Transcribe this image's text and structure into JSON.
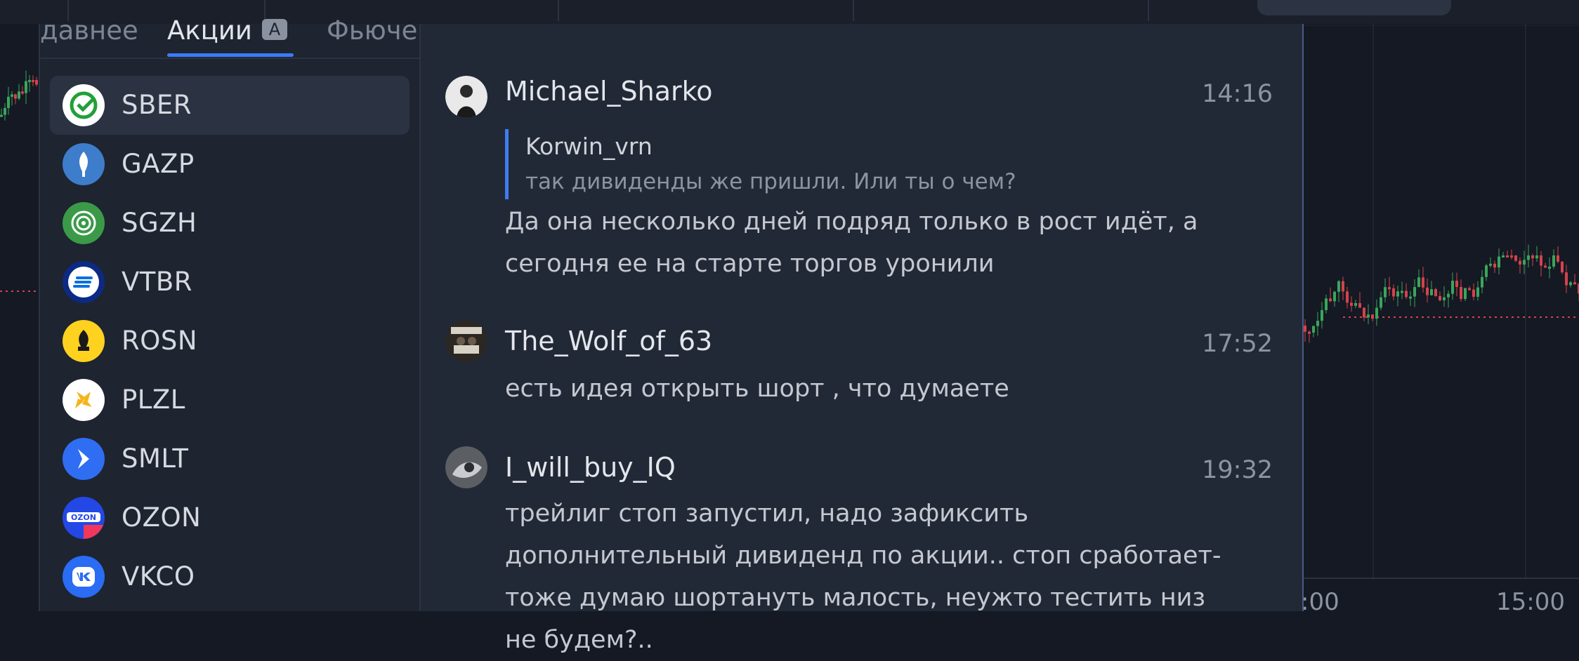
{
  "tabs": [
    {
      "label": "давнее"
    },
    {
      "label": "Акции",
      "badge": "A",
      "active": true
    },
    {
      "label": "Фьюче"
    }
  ],
  "tickers": [
    {
      "symbol": "SBER",
      "icon": "sber-icon",
      "color": "#ffffff",
      "selected": true
    },
    {
      "symbol": "GAZP",
      "icon": "gazprom-icon",
      "color": "#3d7dcb"
    },
    {
      "symbol": "SGZH",
      "icon": "segezha-icon",
      "color": "#3a9a48"
    },
    {
      "symbol": "VTBR",
      "icon": "vtb-icon",
      "color": "#0c2a83"
    },
    {
      "symbol": "ROSN",
      "icon": "rosneft-icon",
      "color": "#ffd21f"
    },
    {
      "symbol": "PLZL",
      "icon": "polyus-icon",
      "color": "#ffffff"
    },
    {
      "symbol": "SMLT",
      "icon": "samolet-icon",
      "color": "#2f6ef3"
    },
    {
      "symbol": "OZON",
      "icon": "ozon-icon",
      "color": "#2348e6"
    },
    {
      "symbol": "VKCO",
      "icon": "vk-icon",
      "color": "#2a6cf3"
    }
  ],
  "messages": [
    {
      "author": "Michael_Sharko",
      "time": "14:16",
      "quote": {
        "author": "Korwin_vrn",
        "text": "так дивиденды же пришли. Или ты о чем?"
      },
      "text": "Да она несколько дней подряд только в рост идёт, а сегодня ее на старте торгов уронили"
    },
    {
      "author": "The_Wolf_of_63",
      "time": "17:52",
      "text": "есть идея открыть шорт , что думаете"
    },
    {
      "author": "I_will_buy_IQ",
      "time": "19:32",
      "text": "трейлиг стоп запустил, надо зафиксить дополнительный дивиденд по акции.. стоп сработает- тоже думаю шортануть малость, неужто тестить низ не будем?.."
    }
  ],
  "chart": {
    "time_labels": [
      ":00",
      "15:00"
    ],
    "up_color": "#3aa55b",
    "down_color": "#d6424c"
  }
}
